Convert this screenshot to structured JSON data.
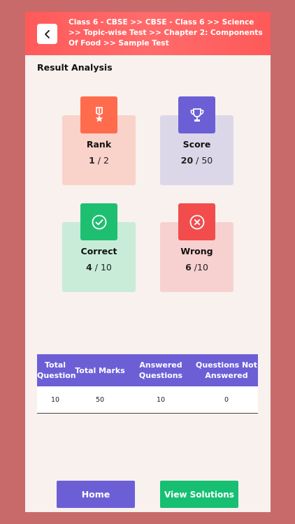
{
  "header": {
    "breadcrumb": "Class  6 - CBSE >> CBSE - Class 6  >> Science >> Topic-wise Test >> Chapter 2: Components Of Food >> Sample Test"
  },
  "section_title": "Result Analysis",
  "cards": {
    "rank": {
      "label": "Rank",
      "value": "1",
      "total": "/ 2",
      "icon": "medal-icon",
      "color": "#ff6b4d"
    },
    "score": {
      "label": "Score",
      "value": "20",
      "total": "/ 50",
      "icon": "trophy-icon",
      "color": "#6c5fd6"
    },
    "correct": {
      "label": "Correct",
      "value": "4",
      "total": "/ 10",
      "icon": "check-circle-icon",
      "color": "#1fbf72"
    },
    "wrong": {
      "label": "Wrong",
      "value": "6",
      "total": "/10",
      "icon": "x-circle-icon",
      "color": "#f24c4c"
    }
  },
  "table": {
    "headers": [
      "Total Question",
      "Total Marks",
      "Answered Questions",
      "Questions Not Answered"
    ],
    "rows": [
      [
        "10",
        "50",
        "10",
        "0"
      ]
    ]
  },
  "buttons": {
    "home": "Home",
    "view_solutions": "View Solutions"
  }
}
